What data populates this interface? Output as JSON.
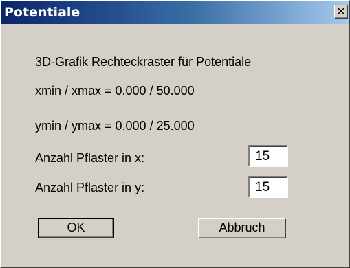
{
  "window": {
    "title": "Potentiale",
    "close_label": "✕"
  },
  "content": {
    "heading": "3D-Grafik Rechteckraster für Potentiale",
    "x_range": "xmin / xmax =  0.000 / 50.000",
    "y_range": "ymin / ymax =  0.000 / 25.000",
    "tiles_x_label": "Anzahl Pflaster in x:",
    "tiles_x_value": "15",
    "tiles_y_label": "Anzahl Pflaster in y:",
    "tiles_y_value": "15"
  },
  "buttons": {
    "ok_label": "OK",
    "cancel_label": "Abbruch"
  }
}
